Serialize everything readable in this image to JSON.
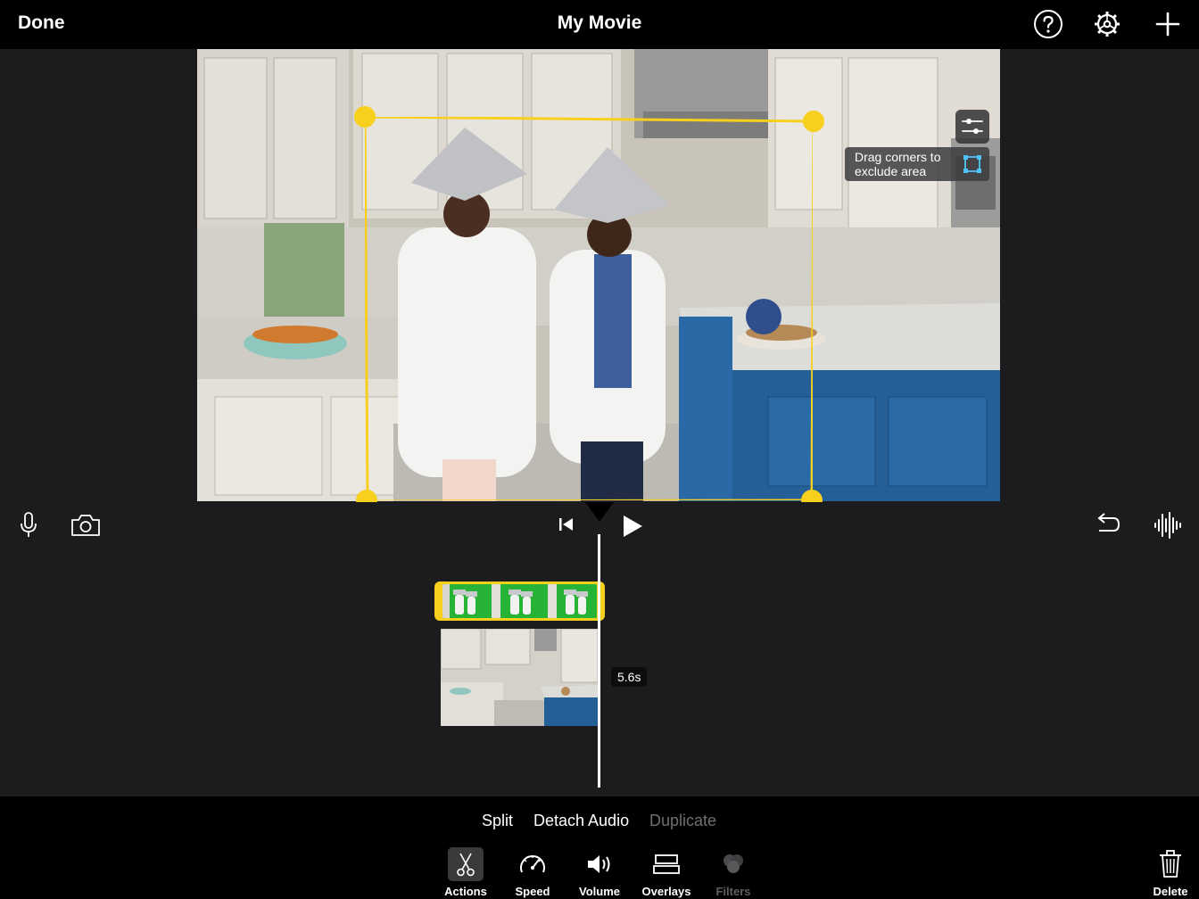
{
  "header": {
    "done_label": "Done",
    "title": "My Movie",
    "icons": [
      "help-icon",
      "settings-gear-icon",
      "add-plus-icon"
    ]
  },
  "viewer": {
    "hint_text": "Drag corners to exclude area",
    "icons": [
      "adjust-sliders-icon",
      "crop-area-icon"
    ]
  },
  "timeline": {
    "duration_label": "5.6s",
    "icons": [
      "microphone-icon",
      "camera-icon",
      "skip-to-start-icon",
      "play-icon",
      "undo-icon",
      "audio-waveform-icon"
    ]
  },
  "actions": {
    "split": "Split",
    "detach_audio": "Detach Audio",
    "duplicate": "Duplicate"
  },
  "tools": [
    {
      "label": "Actions",
      "icon": "scissors-icon",
      "active": true
    },
    {
      "label": "Speed",
      "icon": "speedometer-icon",
      "active": false
    },
    {
      "label": "Volume",
      "icon": "speaker-icon",
      "active": false
    },
    {
      "label": "Overlays",
      "icon": "overlays-icon",
      "active": false
    },
    {
      "label": "Filters",
      "icon": "filters-icon",
      "active": false,
      "disabled": true
    }
  ],
  "delete_label": "Delete",
  "colors": {
    "accent_yellow": "#f7cf1d",
    "green_screen": "#27b336",
    "disabled_text": "#6f6f72",
    "panel_bg": "#1c1c1e"
  }
}
